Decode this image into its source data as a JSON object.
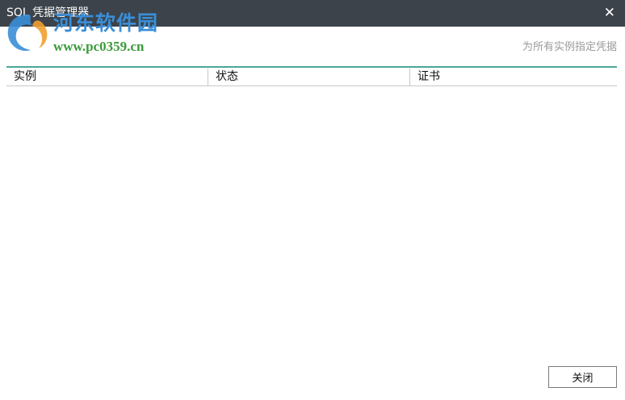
{
  "window": {
    "title": "SQL 凭据管理器",
    "close_glyph": "✕"
  },
  "watermark": {
    "name": "河东软件园",
    "url": "www.pc0359.cn",
    "icon": "watermark-logo-icon"
  },
  "hint": "为所有实例指定凭据",
  "table": {
    "columns": [
      "实例",
      "状态",
      "证书"
    ],
    "rows": []
  },
  "footer": {
    "close_label": "关闭"
  },
  "colors": {
    "titlebar": "#3c434a",
    "accent_line": "#4aa89a",
    "watermark_name": "#3a8ed8",
    "watermark_url": "#3a9a3a"
  }
}
